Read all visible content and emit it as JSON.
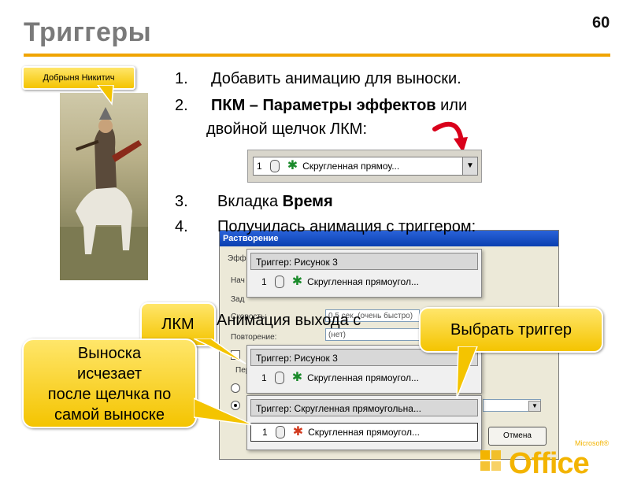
{
  "slide": {
    "title": "Триггеры",
    "page_number": "60"
  },
  "callouts": {
    "dobrynya": "Добрыня Никитич",
    "lkm": "ЛКМ",
    "choose_trigger": "Выбрать триггер",
    "vyn_line1": "Выноска",
    "vyn_line2": "исчезает",
    "vyn_line3": "после щелчка по",
    "vyn_line4": "самой выноске"
  },
  "steps": [
    {
      "num": "1.",
      "text": "Добавить анимацию для выноски."
    },
    {
      "num": "2.",
      "text_bold": "ПКМ – Параметры эффектов",
      "text_rest": " или",
      "line2": "двойной щелчок ЛКМ:"
    },
    {
      "num": "3.",
      "text": "Вкладка ",
      "text_bold": "Время"
    },
    {
      "num": "4.",
      "text": "Получилась  анимация с триггером:"
    }
  ],
  "partial_text": "Анимация выхода с",
  "widget": {
    "order": "1",
    "label": "Скругленная прямоу...",
    "dropdown_arrow": "▼"
  },
  "dialog": {
    "title": "Растворение",
    "tab_label": "Эфф",
    "row_labels": [
      "Нач",
      "Зад",
      "Скорость:",
      "Повторение:",
      "Пер"
    ],
    "speed_value": "0,5 сек. (очень быстро)",
    "repeat_value": "(нет)",
    "cancel_label": "Отмена"
  },
  "triggers": [
    {
      "head": "Триггер: Рисунок 3",
      "order": "1",
      "label": "Скругленная прямоугол...",
      "star": "green"
    },
    {
      "head": "Триггер: Рисунок 3",
      "order": "1",
      "label": "Скругленная прямоугол...",
      "star": "green"
    },
    {
      "head": "Триггер: Скругленная прямоугольна...",
      "order": "1",
      "label": "Скругленная прямоугол...",
      "star": "red"
    }
  ],
  "branding": {
    "office": "Office",
    "microsoft": "Microsoft®"
  },
  "colors": {
    "accent_rule": "#f0a400",
    "callout_fill": "#f4c400",
    "arrow_red": "#d9001b"
  }
}
